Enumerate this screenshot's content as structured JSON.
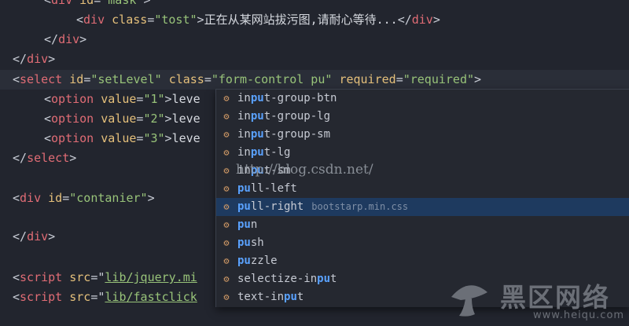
{
  "code": {
    "line1_text": "正在从某网站拔污图,请耐心等待...",
    "tag_div": "div",
    "tag_select": "select",
    "tag_option": "option",
    "tag_script": "script",
    "attr_id": "id",
    "attr_class": "class",
    "attr_required": "required",
    "attr_value": "value",
    "attr_src": "src",
    "val_mask": "\"mask\"",
    "val_tost": "\"tost\"",
    "val_setLevel": "\"setLevel\"",
    "val_class": "\"form-control pu\"",
    "val_required": "\"required\"",
    "val_opt1": "\"1\"",
    "val_opt2": "\"2\"",
    "val_opt3": "\"3\"",
    "opt_text": "leve",
    "val_contanier": "\"contanier\"",
    "src1": "lib/jquery.mi",
    "src2": "lib/fastclick"
  },
  "autocomplete": {
    "items": [
      {
        "pre": "in",
        "m1": "pu",
        "post": "t-group-btn",
        "detail": ""
      },
      {
        "pre": "in",
        "m1": "pu",
        "post": "t-group-lg",
        "detail": ""
      },
      {
        "pre": "in",
        "m1": "pu",
        "post": "t-group-sm",
        "detail": ""
      },
      {
        "pre": "in",
        "m1": "pu",
        "post": "t-lg",
        "detail": ""
      },
      {
        "pre": "in",
        "m1": "pu",
        "post": "t-sm",
        "detail": ""
      },
      {
        "pre": "",
        "m1": "pu",
        "post": "ll-left",
        "detail": ""
      },
      {
        "pre": "",
        "m1": "pu",
        "post": "ll-right",
        "detail": "bootstarp.min.css"
      },
      {
        "pre": "",
        "m1": "pu",
        "post": "n",
        "detail": ""
      },
      {
        "pre": "",
        "m1": "pu",
        "post": "sh",
        "detail": ""
      },
      {
        "pre": "",
        "m1": "pu",
        "post": "zzle",
        "detail": ""
      },
      {
        "pre": "selectize-in",
        "m1": "pu",
        "post": "t",
        "detail": ""
      },
      {
        "pre": "text-in",
        "m1": "pu",
        "post": "t",
        "detail": ""
      }
    ],
    "selected_index": 6,
    "icon": "class-icon"
  },
  "watermark": "http://blog.csdn.net/",
  "logo": {
    "cn": "黑区网络",
    "en": "www.heiqu.com"
  },
  "colors": {
    "background": "#22252e",
    "selection": "#1e3a5f",
    "match": "#5aa2ff"
  }
}
